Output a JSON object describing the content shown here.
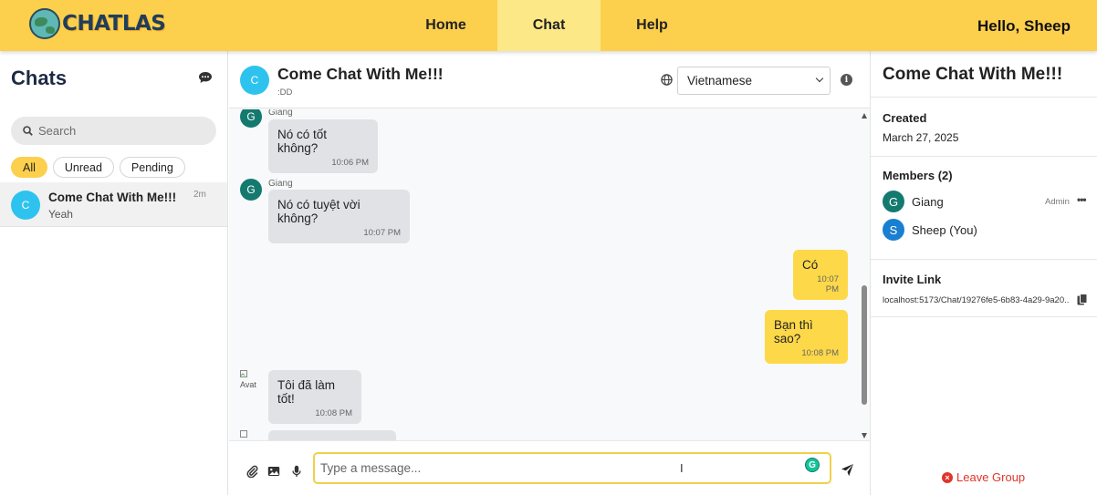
{
  "header": {
    "logo_text": "CHATLAS",
    "nav": [
      {
        "label": "Home",
        "active": false
      },
      {
        "label": "Chat",
        "active": true
      },
      {
        "label": "Help",
        "active": false
      }
    ],
    "greeting": "Hello, Sheep"
  },
  "sidebar": {
    "title": "Chats",
    "search_placeholder": "Search",
    "filters": [
      "All",
      "Unread",
      "Pending"
    ],
    "active_filter": "All",
    "conversations": [
      {
        "avatar": "C",
        "name": "Come Chat With Me!!!",
        "last": "Yeah",
        "time": "2m"
      }
    ]
  },
  "chat": {
    "avatar": "C",
    "title": "Come Chat With Me!!!",
    "subtitle": ":DD",
    "language": "Vietnamese",
    "messages": [
      {
        "dir": "in",
        "sender": "Giang",
        "avatar": "G",
        "text": "Nó có tốt không?",
        "time": "10:06 PM"
      },
      {
        "dir": "in",
        "sender": "Giang",
        "avatar": "G",
        "text": "Nó có tuyệt vời không?",
        "time": "10:07 PM"
      },
      {
        "dir": "out",
        "text": "Có",
        "time": "10:07 PM"
      },
      {
        "dir": "out",
        "text": "Bạn thì sao?",
        "time": "10:08 PM"
      },
      {
        "dir": "in",
        "avatar_alt": "Avat",
        "text": "Tôi đã làm tốt!",
        "time": "10:08 PM"
      }
    ],
    "composer_placeholder": "Type a message..."
  },
  "details": {
    "title": "Come Chat With Me!!!",
    "created_label": "Created",
    "created_value": "March 27, 2025",
    "members_label": "Members (2)",
    "members": [
      {
        "avatar": "G",
        "name": "Giang",
        "role": "Admin",
        "color": "#147a6f"
      },
      {
        "avatar": "S",
        "name": "Sheep (You)",
        "role": "",
        "color": "#1a7fd1"
      }
    ],
    "invite_label": "Invite Link",
    "invite_value": "localhost:5173/Chat/19276fe5-6b83-4a29-9a20...",
    "leave_label": "Leave Group"
  },
  "colors": {
    "accent": "#fccf4d",
    "outgoing": "#fdd848",
    "incoming": "#e1e2e6",
    "danger": "#e0352b"
  }
}
